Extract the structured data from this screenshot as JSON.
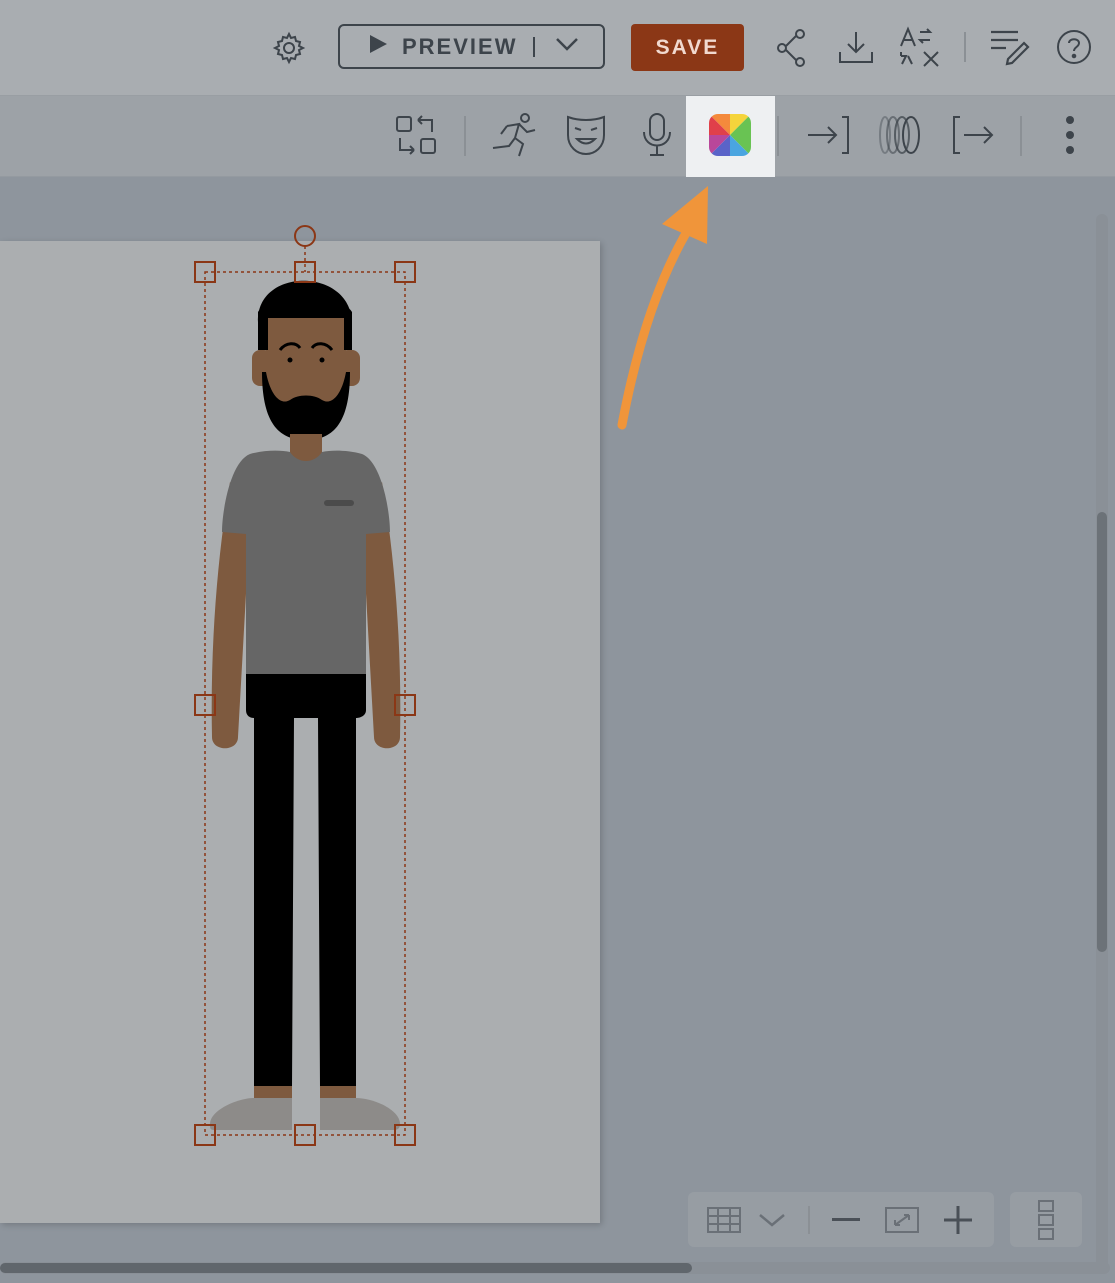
{
  "topbar": {
    "preview_label": "PREVIEW",
    "save_label": "SAVE",
    "icons": [
      "gear-icon",
      "play-icon",
      "chevron-down-icon",
      "share-icon",
      "download-icon",
      "translate-icon",
      "notes-edit-icon",
      "help-icon"
    ]
  },
  "toolbar": {
    "icons": [
      "swap-icon",
      "motion-icon",
      "expression-icon",
      "microphone-icon",
      "color-palette-icon",
      "enter-icon",
      "transition-icon",
      "exit-icon",
      "more-icon"
    ]
  },
  "zoom": {
    "icons": [
      "grid-icon",
      "chevron-down-icon",
      "zoom-out-icon",
      "fit-screen-icon",
      "zoom-in-icon"
    ]
  },
  "colors": {
    "save_button": "#8b3716",
    "selection": "#8b3716",
    "arrow": "#f0953a",
    "highlight": "#eef0f2"
  }
}
